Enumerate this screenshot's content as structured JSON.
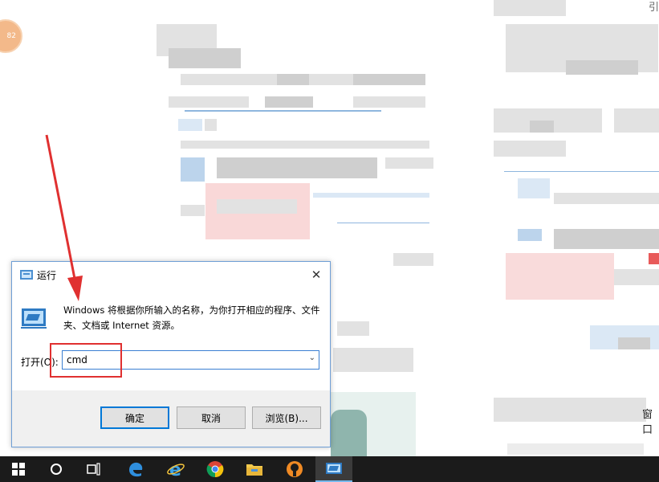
{
  "dialog": {
    "title": "运行",
    "description": "Windows 将根据你所输入的名称，为你打开相应的程序、文件夹、文档或 Internet 资源。",
    "open_label": "打开(O):",
    "input_value": "cmd",
    "buttons": {
      "ok": "确定",
      "cancel": "取消",
      "browse": "浏览(B)..."
    }
  },
  "background_avatar_text": "82",
  "background_fragment_text": "窗口",
  "background_corner_text": "引",
  "colors": {
    "accent": "#0078d7",
    "highlight": "#e03030",
    "taskbar": "#1b1b1b"
  },
  "taskbar": {
    "items": [
      {
        "icon": "windows-start-icon"
      },
      {
        "icon": "cortana-icon"
      },
      {
        "icon": "task-view-icon"
      },
      {
        "icon": "edge-icon"
      },
      {
        "icon": "internet-explorer-icon"
      },
      {
        "icon": "chrome-icon"
      },
      {
        "icon": "file-explorer-icon"
      },
      {
        "icon": "app-icon"
      },
      {
        "icon": "run-icon"
      }
    ]
  }
}
